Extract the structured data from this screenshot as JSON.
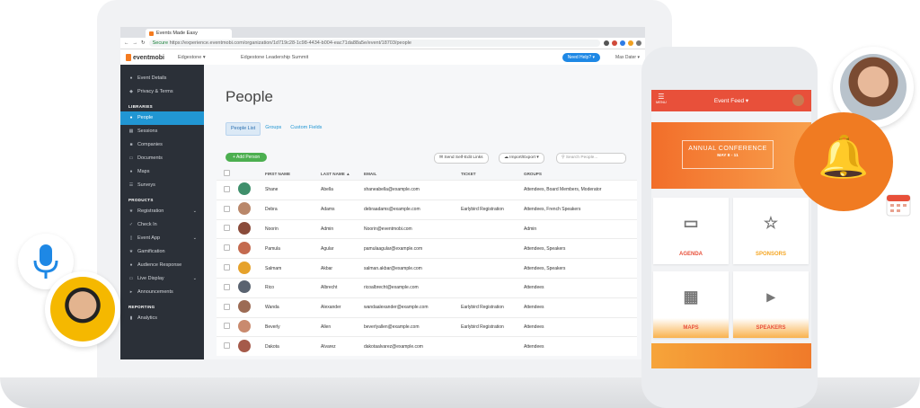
{
  "browser": {
    "tab_title": "Events Made Easy",
    "url_secure": "Secure",
    "url_rest": "https://experience.eventmobi.com/organization/1d719c28-1c98-4434-b004-eac71da88a5e/event/18703/people"
  },
  "app": {
    "logo_text": "eventmobi",
    "org": "Edgestone",
    "event_name": "Edgestone Leadership Summit",
    "need_help": "Need Help?",
    "user": "Max Dater"
  },
  "sidebar": {
    "items": [
      {
        "label": "Event Details",
        "icon": "info-icon"
      },
      {
        "label": "Privacy & Terms",
        "icon": "shield-icon"
      }
    ],
    "libraries_head": "LIBRARIES",
    "libraries": [
      {
        "label": "People",
        "icon": "people-icon",
        "active": true
      },
      {
        "label": "Sessions",
        "icon": "calendar-icon"
      },
      {
        "label": "Companies",
        "icon": "building-icon"
      },
      {
        "label": "Documents",
        "icon": "document-icon"
      },
      {
        "label": "Maps",
        "icon": "map-pin-icon"
      },
      {
        "label": "Surveys",
        "icon": "survey-icon"
      }
    ],
    "products_head": "PRODUCTS",
    "products": [
      {
        "label": "Registration",
        "icon": "registration-icon",
        "caret": true
      },
      {
        "label": "Check In",
        "icon": "check-in-icon"
      },
      {
        "label": "Event App",
        "icon": "phone-icon",
        "caret": true
      },
      {
        "label": "Gamification",
        "icon": "trophy-icon"
      },
      {
        "label": "Audience Response",
        "icon": "chat-icon"
      },
      {
        "label": "Live Display",
        "icon": "monitor-icon",
        "caret": true
      },
      {
        "label": "Announcements",
        "icon": "megaphone-icon"
      }
    ],
    "reporting_head": "REPORTING",
    "reporting": [
      {
        "label": "Analytics",
        "icon": "chart-icon"
      }
    ]
  },
  "main": {
    "title": "People",
    "tabs": [
      "People List",
      "Groups",
      "Custom Fields"
    ],
    "add_person": "+ Add Person",
    "send_links": "Send Self-Edit Links",
    "import_export": "Import/Export",
    "search_placeholder": "Search People...",
    "columns": [
      "FIRST NAME",
      "LAST NAME",
      "EMAIL",
      "TICKET",
      "GROUPS"
    ],
    "rows": [
      {
        "first": "Shane",
        "last": "Abella",
        "email": "shaneabella@example.com",
        "ticket": "",
        "groups": "Attendees, Board Members, Moderator",
        "avatar_color": "#3f8f6b"
      },
      {
        "first": "Debra",
        "last": "Adams",
        "email": "debraadams@example.com",
        "ticket": "Earlybird Registration",
        "groups": "Attendees, French Speakers",
        "avatar_color": "#b9876a"
      },
      {
        "first": "Noorin",
        "last": "Admin",
        "email": "Noorin@eventmobi.com",
        "ticket": "",
        "groups": "Admin",
        "avatar_color": "#8a4b3a"
      },
      {
        "first": "Pamula",
        "last": "Agular",
        "email": "pamulaagular@example.com",
        "ticket": "",
        "groups": "Attendees, Speakers",
        "avatar_color": "#c46a4f"
      },
      {
        "first": "Salmam",
        "last": "Akbar",
        "email": "salman.akbar@example.com",
        "ticket": "",
        "groups": "Attendees, Speakers",
        "avatar_color": "#e6a22b"
      },
      {
        "first": "Rico",
        "last": "Albrecht",
        "email": "ricoalbrecht@example.com",
        "ticket": "",
        "groups": "Attendees",
        "avatar_color": "#5a6370"
      },
      {
        "first": "Wanda",
        "last": "Alexander",
        "email": "wandaalexander@example.com",
        "ticket": "Earlybird Registration",
        "groups": "Attendees",
        "avatar_color": "#9c6b54"
      },
      {
        "first": "Beverly",
        "last": "Allen",
        "email": "beverlyallen@example.com",
        "ticket": "Earlybird Registration",
        "groups": "Attendees",
        "avatar_color": "#c98a6e"
      },
      {
        "first": "Dakota",
        "last": "Alvarez",
        "email": "dakotaalvarez@example.com",
        "ticket": "",
        "groups": "Attendees",
        "avatar_color": "#a55a4a"
      }
    ]
  },
  "phone": {
    "menu": "MENU",
    "title": "Event Feed",
    "banner_title": "ANNUAL CONFERENCE",
    "banner_date": "MAY 8 - 11",
    "tiles": [
      {
        "label": "AGENDA",
        "color": "#e8503a",
        "icon": "agenda-icon"
      },
      {
        "label": "SPONSORS",
        "color": "#f5a623",
        "icon": "sponsor-badge-icon"
      },
      {
        "label": "MAPS",
        "color": "#e8503a",
        "icon": "map-grid-icon"
      },
      {
        "label": "SPEAKERS",
        "color": "#e8503a",
        "icon": "megaphone-icon"
      }
    ]
  },
  "colors": {
    "accent_blue": "#2196d3",
    "sidebar_bg": "#2b3038",
    "brand_orange": "#f07b22",
    "add_green": "#4caf50"
  }
}
